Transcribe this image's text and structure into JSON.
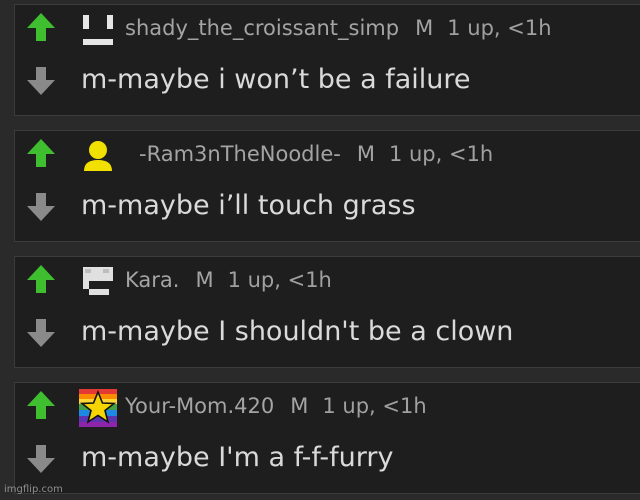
{
  "comments": [
    {
      "username": "shady_the_croissant_simp",
      "mod_badge": "M",
      "meta": "1 up, <1h",
      "text": "m-maybe i won’t be a failure",
      "avatar_icon": "minimal-face-icon"
    },
    {
      "username": "-Ram3nTheNoodle-",
      "mod_badge": "M",
      "meta": "1 up, <1h",
      "text": "m-maybe i’ll touch grass",
      "avatar_icon": "yellow-person-icon"
    },
    {
      "username": "Kara.",
      "mod_badge": "M",
      "meta": "1 up, <1h",
      "text": "m-maybe I shouldn't be a clown",
      "avatar_icon": "pixel-face-icon"
    },
    {
      "username": "Your-Mom.420",
      "mod_badge": "M",
      "meta": "1 up, <1h",
      "text": "m-maybe I'm a f-f-furry",
      "avatar_icon": "rainbow-star-icon"
    }
  ],
  "watermark": "imgflip.com",
  "colors": {
    "upvote": "#3fbf2f",
    "downvote": "#8a8a8a",
    "card_bg": "#1e1e1e",
    "page_bg": "#2a2a2a"
  }
}
